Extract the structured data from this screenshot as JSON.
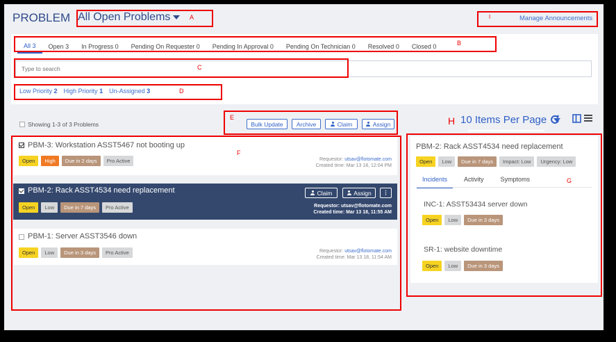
{
  "header": {
    "title": "PROBLEM",
    "filter_label": "All Open Problems",
    "manage_link": "Manage Announcements"
  },
  "status_tabs": [
    {
      "label": "All",
      "count": "3",
      "active": true
    },
    {
      "label": "Open",
      "count": "3"
    },
    {
      "label": "In Progress",
      "count": "0"
    },
    {
      "label": "Pending On Requester",
      "count": "0"
    },
    {
      "label": "Pending In Approval",
      "count": "0"
    },
    {
      "label": "Pending On Technician",
      "count": "0"
    },
    {
      "label": "Resolved",
      "count": "0"
    },
    {
      "label": "Closed",
      "count": "0"
    }
  ],
  "search": {
    "placeholder": "Type to search"
  },
  "quick_filters": [
    {
      "label": "Low Priority",
      "count": "2"
    },
    {
      "label": "High Priority",
      "count": "1"
    },
    {
      "label": "Un-Assigned",
      "count": "3"
    }
  ],
  "list": {
    "showing": "Showing 1-3 of 3 Problems",
    "buttons": {
      "bulk_update": "Bulk Update",
      "archive": "Archive",
      "claim": "Claim",
      "assign": "Assign"
    },
    "per_page": "10 Items Per Page",
    "problems": [
      {
        "title": "PBM-3: Workstation ASST5467 not booting up",
        "badges": [
          "Open",
          "High",
          "Due in 2 days",
          "Pro Active"
        ],
        "requestor_label": "Requestor:",
        "requestor": "utsav@flotomate.com",
        "created": "Created time: Mar 13 18, 12:04 PM"
      },
      {
        "title": "PBM-2: Rack ASST4534 need replacement",
        "badges": [
          "Open",
          "Low",
          "Due in 7 days",
          "Pro Active"
        ],
        "requestor_label": "Requestor:",
        "requestor": "utsav@flotomate.com",
        "created": "Created time: Mar 13 18, 11:55 AM",
        "claim": "Claim",
        "assign": "Assign"
      },
      {
        "title": "PBM-1: Server ASST3546 down",
        "badges": [
          "Open",
          "Low",
          "Due in 3 days",
          "Pro Active"
        ],
        "requestor_label": "Requestor:",
        "requestor": "utsav@flotomate.com",
        "created": "Created time: Mar 13 18, 11:54 AM"
      }
    ]
  },
  "detail": {
    "title": "PBM-2: Rack ASST4534 need replacement",
    "badges": [
      "Open",
      "Low",
      "Due in 7 days",
      "Impact: Low",
      "Urgency: Low"
    ],
    "tabs": [
      "Incidents",
      "Activity",
      "Symptoms"
    ],
    "incidents": [
      {
        "title": "INC-1: ASST53434 server down",
        "badges": [
          "Open",
          "Low",
          "Due in 3 days"
        ]
      },
      {
        "title": "SR-1: website downtime",
        "badges": [
          "Open",
          "Low",
          "Due in 3 days"
        ]
      }
    ]
  },
  "annotations": [
    "A",
    "B",
    "C",
    "D",
    "E",
    "F",
    "G",
    "H",
    "I"
  ],
  "colors": {
    "accent": "#2f5fc5",
    "annotation": "#e00000",
    "selected_row": "#34486e",
    "open": "#f6d322",
    "high": "#f07a24",
    "due": "#b9957a"
  }
}
